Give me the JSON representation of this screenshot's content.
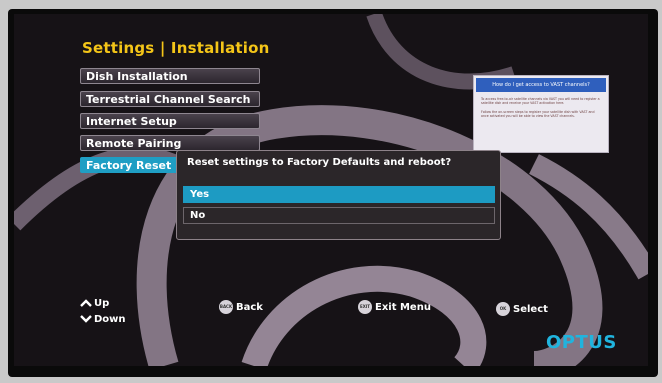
{
  "page": {
    "title": "Settings | Installation"
  },
  "menu": {
    "items": [
      {
        "label": "Dish Installation"
      },
      {
        "label": "Terrestrial Channel Search"
      },
      {
        "label": "Internet Setup"
      },
      {
        "label": "Remote Pairing"
      },
      {
        "label": "Factory Reset",
        "active": true
      }
    ]
  },
  "dialog": {
    "question": "Reset settings to Factory Defaults and reboot?",
    "options": [
      {
        "label": "Yes",
        "selected": true
      },
      {
        "label": "No",
        "selected": false
      }
    ]
  },
  "info_card": {
    "title": "How do I get access to VAST channels?",
    "paragraphs": [
      "To access free-to-air satellite channels via VAST you will need to register a satellite dish and receive your VAST activation here.",
      "Follow the on-screen steps to register your satellite dish with VAST and once activated you will be able to view the VAST channels."
    ]
  },
  "footer": {
    "up": "Up",
    "down": "Down",
    "back": "Back",
    "back_key": "BACK",
    "exit": "Exit Menu",
    "exit_key": "EXIT",
    "select": "Select",
    "select_key": "OK"
  },
  "brand": {
    "logo": "OPTUS",
    "accent": "#1f9ec4",
    "title_color": "#f4c518"
  }
}
